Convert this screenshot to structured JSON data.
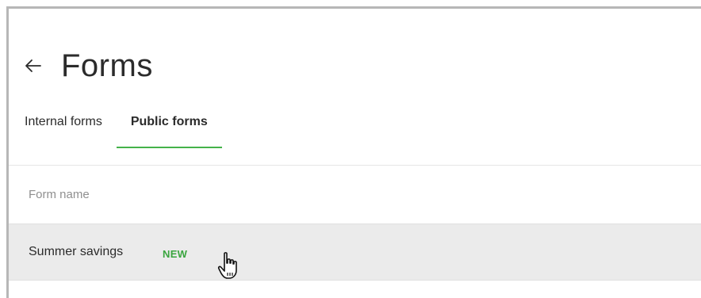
{
  "header": {
    "title": "Forms",
    "back_icon": "arrow-left-icon"
  },
  "tabs": [
    {
      "label": "Internal forms",
      "active": false
    },
    {
      "label": "Public forms",
      "active": true
    }
  ],
  "table": {
    "column_header": "Form name",
    "rows": [
      {
        "name": "Summer savings",
        "badge": "NEW"
      }
    ]
  },
  "colors": {
    "accent": "#44b24a",
    "badge": "#3aa53f",
    "row_hover": "#ebebeb",
    "frame_border": "#b7b7b7"
  },
  "cursor_icon": "hand-pointer-icon"
}
